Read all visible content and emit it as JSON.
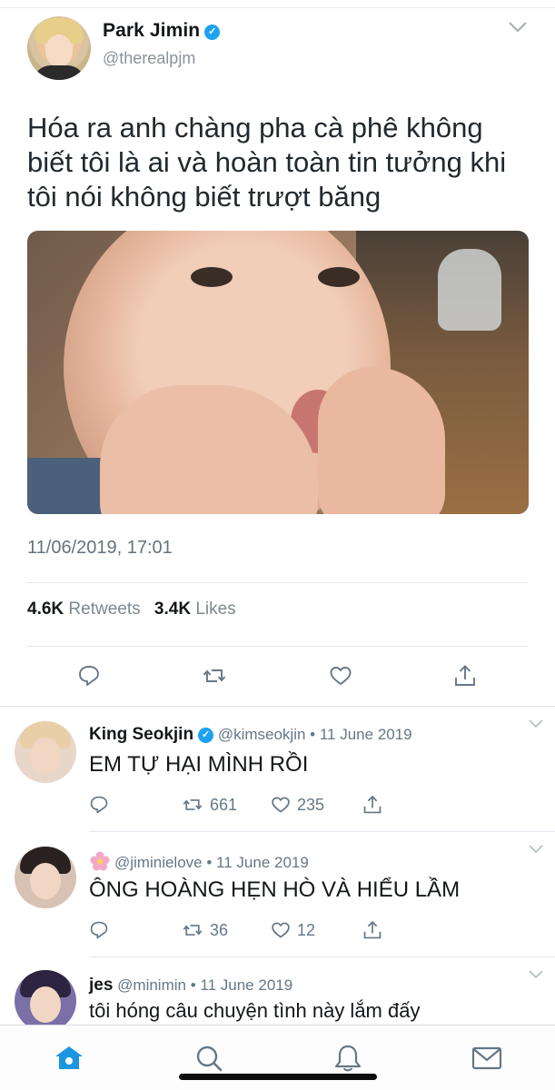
{
  "main_tweet": {
    "author_name": "Park Jimin",
    "author_handle": "@therealpjm",
    "verified_mark": "✓",
    "text": "Hóa ra anh chàng pha cà phê không biết tôi là ai và hoàn toàn tin tưởng khi tôi nói không biết trượt băng",
    "timestamp": "11/06/2019, 17:01",
    "retweets_count": "4.6K",
    "retweets_label": "Retweets",
    "likes_count": "3.4K",
    "likes_label": "Likes",
    "actions": [
      "reply-icon",
      "retweet-icon",
      "like-icon",
      "share-icon"
    ]
  },
  "replies": [
    {
      "name": "King Seokjin",
      "verified_mark": "✓",
      "handle": "@kimseokjin",
      "separator": "•",
      "date": "11 June 2019",
      "text": "EM TỰ HẠI MÌNH RỒI",
      "retweets": "661",
      "likes": "235"
    },
    {
      "name": "",
      "name_icon": "flower-icon",
      "handle": "@jiminielove",
      "separator": "•",
      "date": "11 June 2019",
      "text": "ÔNG HOÀNG HẸN HÒ VÀ HIỂU LẦM",
      "retweets": "36",
      "likes": "12"
    },
    {
      "name": "jes",
      "handle": "@minimin",
      "separator": "•",
      "date": "11 June 2019",
      "text": "tôi hóng câu chuyện tình này lắm đấy"
    }
  ],
  "bottom_nav": [
    "home-icon",
    "search-icon",
    "notifications-icon",
    "messages-icon"
  ],
  "colors": {
    "accent": "#1da1f2",
    "nav_active": "#1b95e0",
    "text_secondary": "#657786"
  }
}
